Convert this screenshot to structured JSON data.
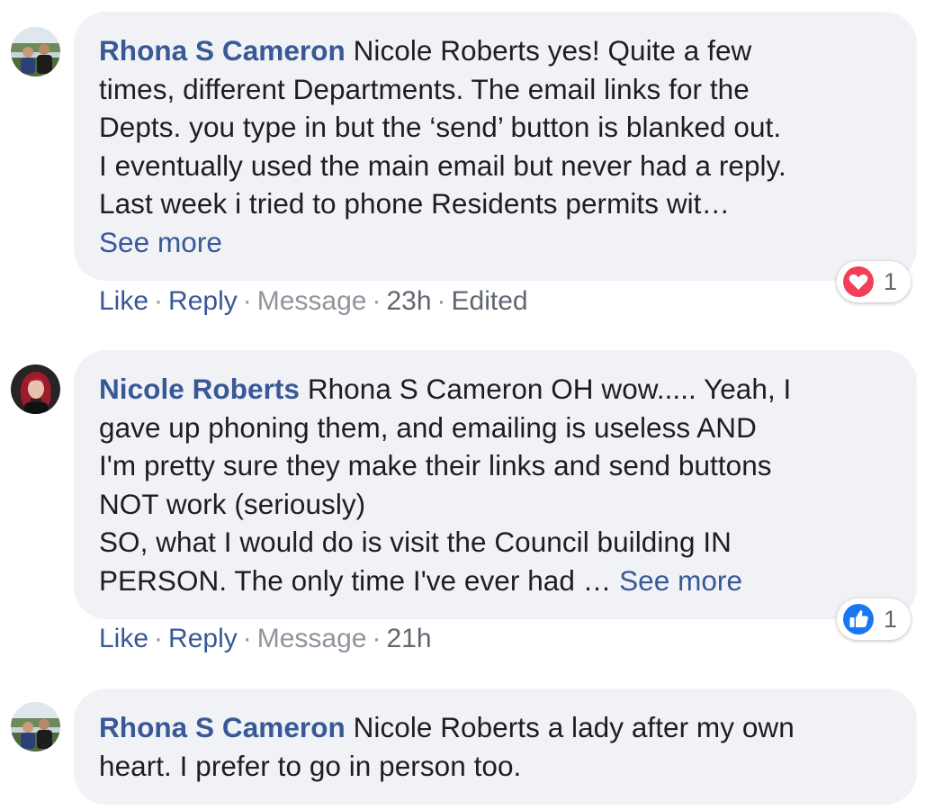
{
  "comments": [
    {
      "author": "Rhona S Cameron",
      "text_lines": [
        "Nicole Roberts yes! Quite a few",
        "times, different Departments. The email links for the",
        "Depts. you type in but the ‘send’ button is blanked out.",
        "I eventually used the main email but never had a reply.",
        "Last week i tried to phone Residents permits wit…"
      ],
      "see_more": "See more",
      "actions": {
        "like": "Like",
        "reply": "Reply",
        "message": "Message",
        "time": "23h",
        "edited": "Edited"
      },
      "reaction": {
        "icon": "heart-reaction-icon",
        "count": "1",
        "color": "#f33e58"
      }
    },
    {
      "author": "Nicole Roberts",
      "text_lines": [
        "Rhona S Cameron OH wow..... Yeah, I",
        "gave up phoning them, and emailing is useless AND",
        "I'm pretty sure they make their links and send buttons",
        "NOT work (seriously)",
        "SO, what I would do is visit the Council building IN",
        "PERSON. The only time I've ever had … "
      ],
      "see_more": "See more",
      "actions": {
        "like": "Like",
        "reply": "Reply",
        "message": "Message",
        "time": "21h"
      },
      "reaction": {
        "icon": "like-reaction-icon",
        "count": "1",
        "color": "#1877f2"
      }
    },
    {
      "author": "Rhona S Cameron",
      "text_lines": [
        "Nicole Roberts a lady after my own",
        "heart. I prefer to go in person too."
      ]
    }
  ],
  "separator": "·",
  "colors": {
    "link": "#385898",
    "bubble_bg": "#f0f2f5",
    "muted": "#90949c",
    "text": "#1c1e21"
  }
}
